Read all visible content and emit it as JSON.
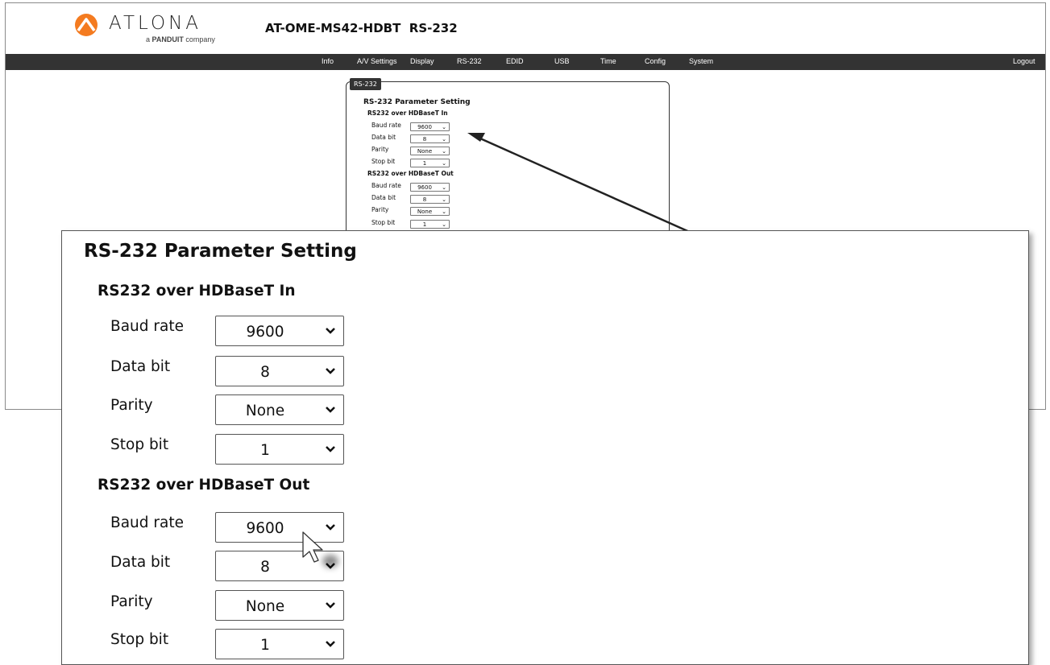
{
  "header": {
    "brand": "ATLONA",
    "tagline_prefix": "a ",
    "tagline_brand": "PANDUIT",
    "tagline_suffix": " company",
    "product_title": "AT-OME-MS42-HDBT  RS-232"
  },
  "nav": {
    "items": [
      "Info",
      "A/V Settings",
      "Display",
      "RS-232",
      "EDID",
      "USB",
      "Time",
      "Config",
      "System"
    ],
    "logout": "Logout"
  },
  "panel": {
    "tab_label": "RS-232",
    "title": "RS-232 Parameter Setting",
    "sections": [
      {
        "heading": "RS232 over HDBaseT In",
        "fields": [
          {
            "label": "Baud rate",
            "value": "9600"
          },
          {
            "label": "Data bit",
            "value": "8"
          },
          {
            "label": "Parity",
            "value": "None"
          },
          {
            "label": "Stop bit",
            "value": "1"
          }
        ]
      },
      {
        "heading": "RS232 over HDBaseT Out",
        "fields": [
          {
            "label": "Baud rate",
            "value": "9600"
          },
          {
            "label": "Data bit",
            "value": "8"
          },
          {
            "label": "Parity",
            "value": "None"
          },
          {
            "label": "Stop bit",
            "value": "1"
          }
        ]
      }
    ]
  },
  "colors": {
    "navbar_bg": "#333333",
    "logo_orange": "#f47b20"
  },
  "icons": {
    "logo": "atlona-logo-icon",
    "select_caret": "chevron-down-icon",
    "pointer": "mouse-pointer-icon",
    "callout": "callout-arrow-icon"
  }
}
